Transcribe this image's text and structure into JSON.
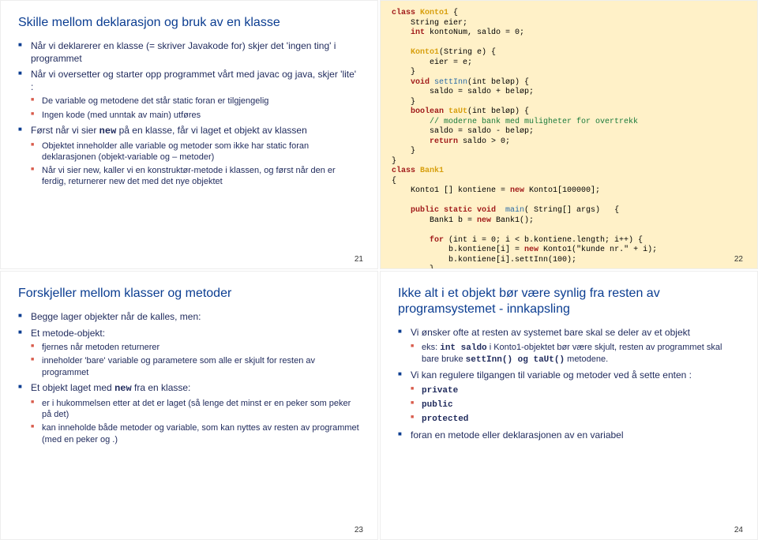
{
  "slides": {
    "s21": {
      "number": "21",
      "title": "Skille mellom deklarasjon og bruk av en klasse",
      "b1": "Når vi deklarerer en klasse (= skriver Javakode for) skjer det 'ingen ting' i programmet",
      "b2": "Når vi oversetter og starter opp programmet vårt med javac og java, skjer 'lite' :",
      "b2a": "De variable og metodene det står static foran er tilgjengelig",
      "b2b": "Ingen kode (med unntak av main) utføres",
      "b3_pre": "Først når vi sier ",
      "b3_kw": "new",
      "b3_post": " på en klasse, får vi laget et objekt av klassen",
      "b3a": "Objektet inneholder alle variable og metoder som ikke har static foran deklarasjonen (objekt-variable og – metoder)",
      "b3b": "Når vi sier new, kaller vi en konstruktør-metode i klassen, og først når den er ferdig, returnerer new det med det nye objektet"
    },
    "s22": {
      "number": "22",
      "code_lines": [
        {
          "t": "class ",
          "k": "kw"
        },
        {
          "t": "Konto1",
          "k": "cls"
        },
        {
          "t": " {",
          "k": ""
        },
        {
          "nl": 1
        },
        {
          "t": "    String eier;",
          "k": ""
        },
        {
          "nl": 1
        },
        {
          "t": "    int",
          "k": "kw"
        },
        {
          "t": " kontoNum, saldo = 0;",
          "k": ""
        },
        {
          "nl": 1
        },
        {
          "nl": 1
        },
        {
          "t": "    Konto1",
          "k": "cls"
        },
        {
          "t": "(String e) {",
          "k": ""
        },
        {
          "nl": 1
        },
        {
          "t": "        eier = e;",
          "k": ""
        },
        {
          "nl": 1
        },
        {
          "t": "    }",
          "k": ""
        },
        {
          "nl": 1
        },
        {
          "t": "    void ",
          "k": "kw"
        },
        {
          "t": "settInn",
          "k": "mtd"
        },
        {
          "t": "(int",
          "k": ""
        },
        {
          "t": " beløp) {",
          "k": ""
        },
        {
          "nl": 1
        },
        {
          "t": "        saldo = saldo + beløp;",
          "k": ""
        },
        {
          "nl": 1
        },
        {
          "t": "    }",
          "k": ""
        },
        {
          "nl": 1
        },
        {
          "t": "    boolean ",
          "k": "kw"
        },
        {
          "t": "taUt",
          "k": "cls"
        },
        {
          "t": "(int",
          "k": ""
        },
        {
          "t": " beløp) {",
          "k": ""
        },
        {
          "nl": 1
        },
        {
          "t": "        // moderne bank med muligheter for overtrekk",
          "k": "cmt"
        },
        {
          "nl": 1
        },
        {
          "t": "        saldo = saldo - beløp;",
          "k": ""
        },
        {
          "nl": 1
        },
        {
          "t": "        return",
          "k": "kw"
        },
        {
          "t": " saldo > 0;",
          "k": ""
        },
        {
          "nl": 1
        },
        {
          "t": "    }",
          "k": ""
        },
        {
          "nl": 1
        },
        {
          "t": "}",
          "k": ""
        },
        {
          "nl": 1
        },
        {
          "t": "class ",
          "k": "kw"
        },
        {
          "t": "Bank1",
          "k": "cls"
        },
        {
          "nl": 1
        },
        {
          "t": "{",
          "k": ""
        },
        {
          "nl": 1
        },
        {
          "t": "    Konto1 [] kontiene = ",
          "k": ""
        },
        {
          "t": "new",
          "k": "kw"
        },
        {
          "t": " Konto1[100000];",
          "k": ""
        },
        {
          "nl": 1
        },
        {
          "nl": 1
        },
        {
          "t": "    public static void ",
          "k": "kw"
        },
        {
          "t": " main",
          "k": "mtd"
        },
        {
          "t": "( String[] args)   {",
          "k": ""
        },
        {
          "nl": 1
        },
        {
          "t": "        Bank1 b = ",
          "k": ""
        },
        {
          "t": "new",
          "k": "kw"
        },
        {
          "t": " Bank1();",
          "k": ""
        },
        {
          "nl": 1
        },
        {
          "nl": 1
        },
        {
          "t": "        for",
          "k": "kw"
        },
        {
          "t": " (int i = 0; i < b.kontiene.length; i++) {",
          "k": ""
        },
        {
          "nl": 1
        },
        {
          "t": "            b.kontiene[i] = ",
          "k": ""
        },
        {
          "t": "new",
          "k": "kw"
        },
        {
          "t": " Konto1(\"kunde nr.\" + i);",
          "k": ""
        },
        {
          "nl": 1
        },
        {
          "t": "            b.kontiene[i].settInn(100);",
          "k": ""
        },
        {
          "nl": 1
        },
        {
          "t": "        }",
          "k": ""
        },
        {
          "nl": 1
        },
        {
          "t": "    }",
          "k": ""
        },
        {
          "nl": 1
        },
        {
          "t": "}",
          "k": ""
        }
      ]
    },
    "s23": {
      "number": "23",
      "title": "Forskjeller mellom klasser og metoder",
      "b1": "Begge lager objekter når de kalles, men:",
      "b2": "Et metode-objekt:",
      "b2a": "fjernes når metoden returnerer",
      "b2b": "inneholder 'bare' variable og parametere som alle er skjult for resten av programmet",
      "b3_pre": "Et objekt laget med ",
      "b3_kw": "new",
      "b3_post": " fra en klasse:",
      "b3a": "er i hukommelsen etter at det er laget (så lenge det minst er en peker som peker på det)",
      "b3b": "kan inneholde både metoder og variable, som kan nyttes av resten av programmet (med en peker og .)"
    },
    "s24": {
      "number": "24",
      "title": "Ikke alt i et objekt bør være synlig fra resten av programsystemet - innkapsling",
      "b1": "Vi ønsker ofte at resten av systemet bare skal se deler av et objekt",
      "b1a_pre": "eks: ",
      "b1a_code1": "int saldo",
      "b1a_mid": " i Konto1-objektet bør være skjult, resten av programmet skal bare bruke ",
      "b1a_code2": "settInn()",
      "b1a_og": " og ",
      "b1a_code3": "taUt()",
      "b1a_post": " metodene.",
      "b2": "Vi kan regulere tilgangen til variable og metoder ved å sette enten :",
      "b2a": "private",
      "b2b": "public",
      "b2c": "protected",
      "b3": "foran en metode eller deklarasjonen av en variabel"
    }
  }
}
